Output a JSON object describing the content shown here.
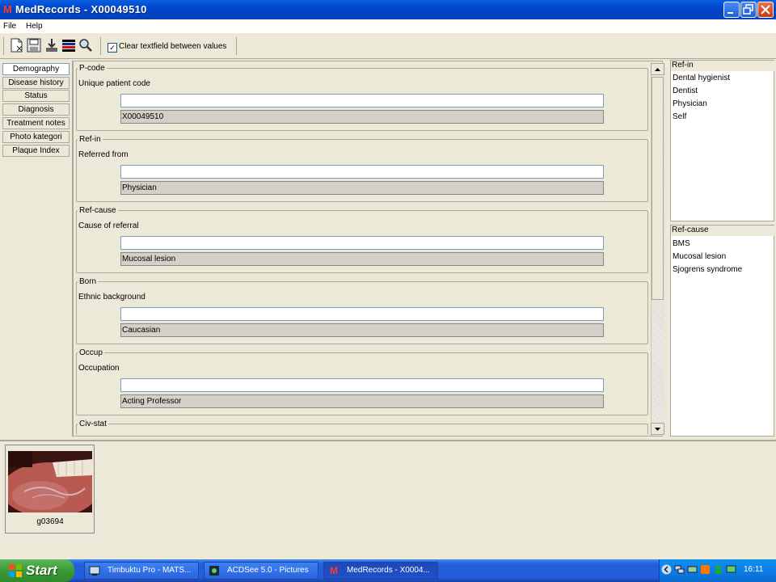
{
  "window": {
    "title": "MedRecords - X00049510"
  },
  "menu": {
    "items": [
      "File",
      "Help"
    ]
  },
  "toolbar": {
    "tools": [
      "new-record-icon",
      "save-icon",
      "import-icon",
      "chart-icon",
      "search-icon"
    ],
    "checkbox_label": "Clear textfield between values",
    "checkbox_checked": "✓"
  },
  "nav": {
    "items": [
      "Demography",
      "Disease history",
      "Status",
      "Diagnosis",
      "Treatment notes",
      "Photo kategori",
      "Plaque Index"
    ]
  },
  "form": {
    "groups": [
      {
        "title": "P-code",
        "label": "Unique patient code",
        "value": "X00049510"
      },
      {
        "title": "Ref-in",
        "label": "Referred from",
        "value": "Physician"
      },
      {
        "title": "Ref-cause",
        "label": "Cause of referral",
        "value": "Mucosal lesion"
      },
      {
        "title": "Born",
        "label": "Ethnic background",
        "value": "Caucasian"
      },
      {
        "title": "Occup",
        "label": "Occupation",
        "value": "Acting Professor"
      },
      {
        "title": "Civ-stat"
      }
    ]
  },
  "right_lists": {
    "refin": {
      "title": "Ref-in",
      "items": [
        "Dental hygienist",
        "Dentist",
        "Physician",
        "Self"
      ]
    },
    "refcause": {
      "title": "Ref-cause",
      "items": [
        "BMS",
        "Mucosal lesion",
        "Sjogrens syndrome"
      ]
    }
  },
  "images": {
    "thumbnail_caption": "g03694"
  },
  "taskbar": {
    "start_label": "Start",
    "tasks": [
      "Timbuktu Pro - MATS...",
      "ACDSee 5.0 - Pictures",
      "MedRecords - X0004..."
    ],
    "clock": "16:11"
  },
  "colors": {
    "titlebar": "#0047cf",
    "taskbar": "#245edb",
    "start": "#3a9a35",
    "accent": "#ff3b1f"
  }
}
